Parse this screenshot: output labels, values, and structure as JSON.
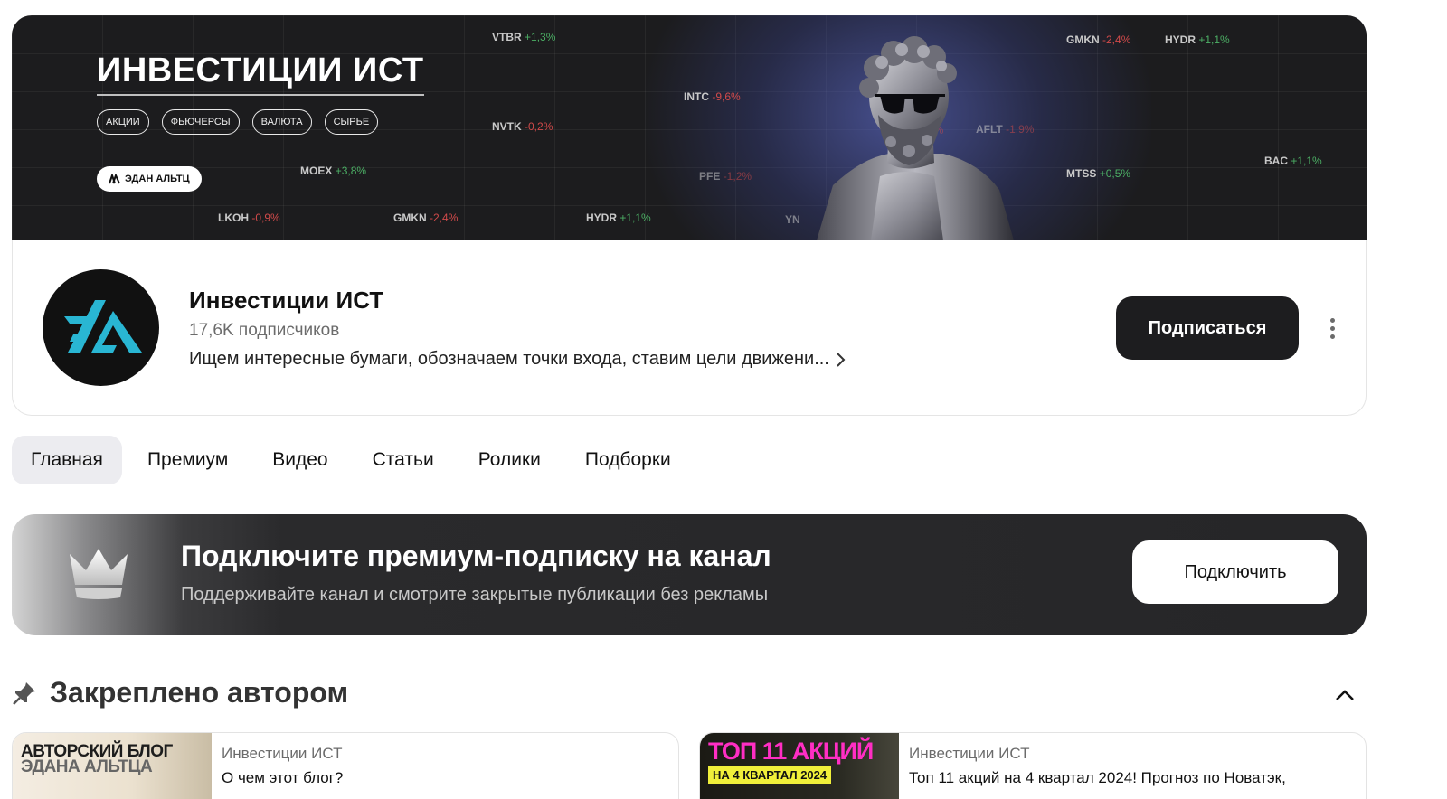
{
  "banner": {
    "title": "ИНВЕСТИЦИИ ИСТ",
    "tags": [
      "АКЦИИ",
      "ФЬЮЧЕРСЫ",
      "ВАЛЮТА",
      "СЫРЬЕ"
    ],
    "author_pill": "ЭДАН АЛЬТЦ",
    "tickers": [
      {
        "symbol": "VTBR",
        "change": "+1,3%",
        "dir": "up"
      },
      {
        "symbol": "GMKN",
        "change": "-2,4%",
        "dir": "down"
      },
      {
        "symbol": "HYDR",
        "change": "+1,1%",
        "dir": "up"
      },
      {
        "symbol": "INTC",
        "change": "-9,6%",
        "dir": "down"
      },
      {
        "symbol": "NVTK",
        "change": "-0,2%",
        "dir": "down"
      },
      {
        "symbol": "AFLT",
        "change": "-1,9%",
        "dir": "down"
      },
      {
        "symbol": "MOEX",
        "change": "+3,8%",
        "dir": "up"
      },
      {
        "symbol": "PFE",
        "change": "-1,2%",
        "dir": "down"
      },
      {
        "symbol": "MTSS",
        "change": "+0,5%",
        "dir": "up"
      },
      {
        "symbol": "BAC",
        "change": "+1,1%",
        "dir": "up"
      },
      {
        "symbol": "LKOH",
        "change": "-0,9%",
        "dir": "down"
      },
      {
        "symbol": "GMKN",
        "change": "-2,4%",
        "dir": "down"
      },
      {
        "symbol": "HYDR",
        "change": "+1,1%",
        "dir": "up"
      },
      {
        "symbol": "YN",
        "change": "",
        "dir": "up"
      },
      {
        "symbol": "",
        "change": "2,8%",
        "dir": "down"
      }
    ]
  },
  "channel": {
    "name": "Инвестиции ИСТ",
    "subscribers": "17,6K подписчиков",
    "description": "Ищем интересные бумаги, обозначаем точки входа, ставим цели движени...",
    "subscribe_label": "Подписаться"
  },
  "tabs": [
    {
      "label": "Главная",
      "active": true
    },
    {
      "label": "Премиум",
      "active": false
    },
    {
      "label": "Видео",
      "active": false
    },
    {
      "label": "Статьи",
      "active": false
    },
    {
      "label": "Ролики",
      "active": false
    },
    {
      "label": "Подборки",
      "active": false
    }
  ],
  "premium": {
    "title": "Подключите премиум-подписку на канал",
    "subtitle": "Поддерживайте канал и смотрите закрытые публикации без рекламы",
    "button_label": "Подключить"
  },
  "pinned": {
    "title": "Закреплено автором",
    "posts": [
      {
        "thumb_line1": "АВТОРСКИЙ БЛОГ",
        "thumb_line2": "ЭДАНА АЛЬТЦА",
        "author": "Инвестиции ИСТ",
        "title": "О чем этот блог?"
      },
      {
        "thumb_line1": "ТОП 11 АКЦИЙ",
        "thumb_line2": "НА 4 КВАРТАЛ 2024",
        "author": "Инвестиции ИСТ",
        "title": "Топ 11 акций на 4 квартал 2024! Прогноз по Новатэк,"
      }
    ]
  },
  "colors": {
    "banner_bg": "#1c1c1e",
    "accent_teal": "#29b6d3",
    "ticker_up": "#4caf65",
    "ticker_down": "#d14a4a",
    "button_dark": "#1d1d1f"
  }
}
